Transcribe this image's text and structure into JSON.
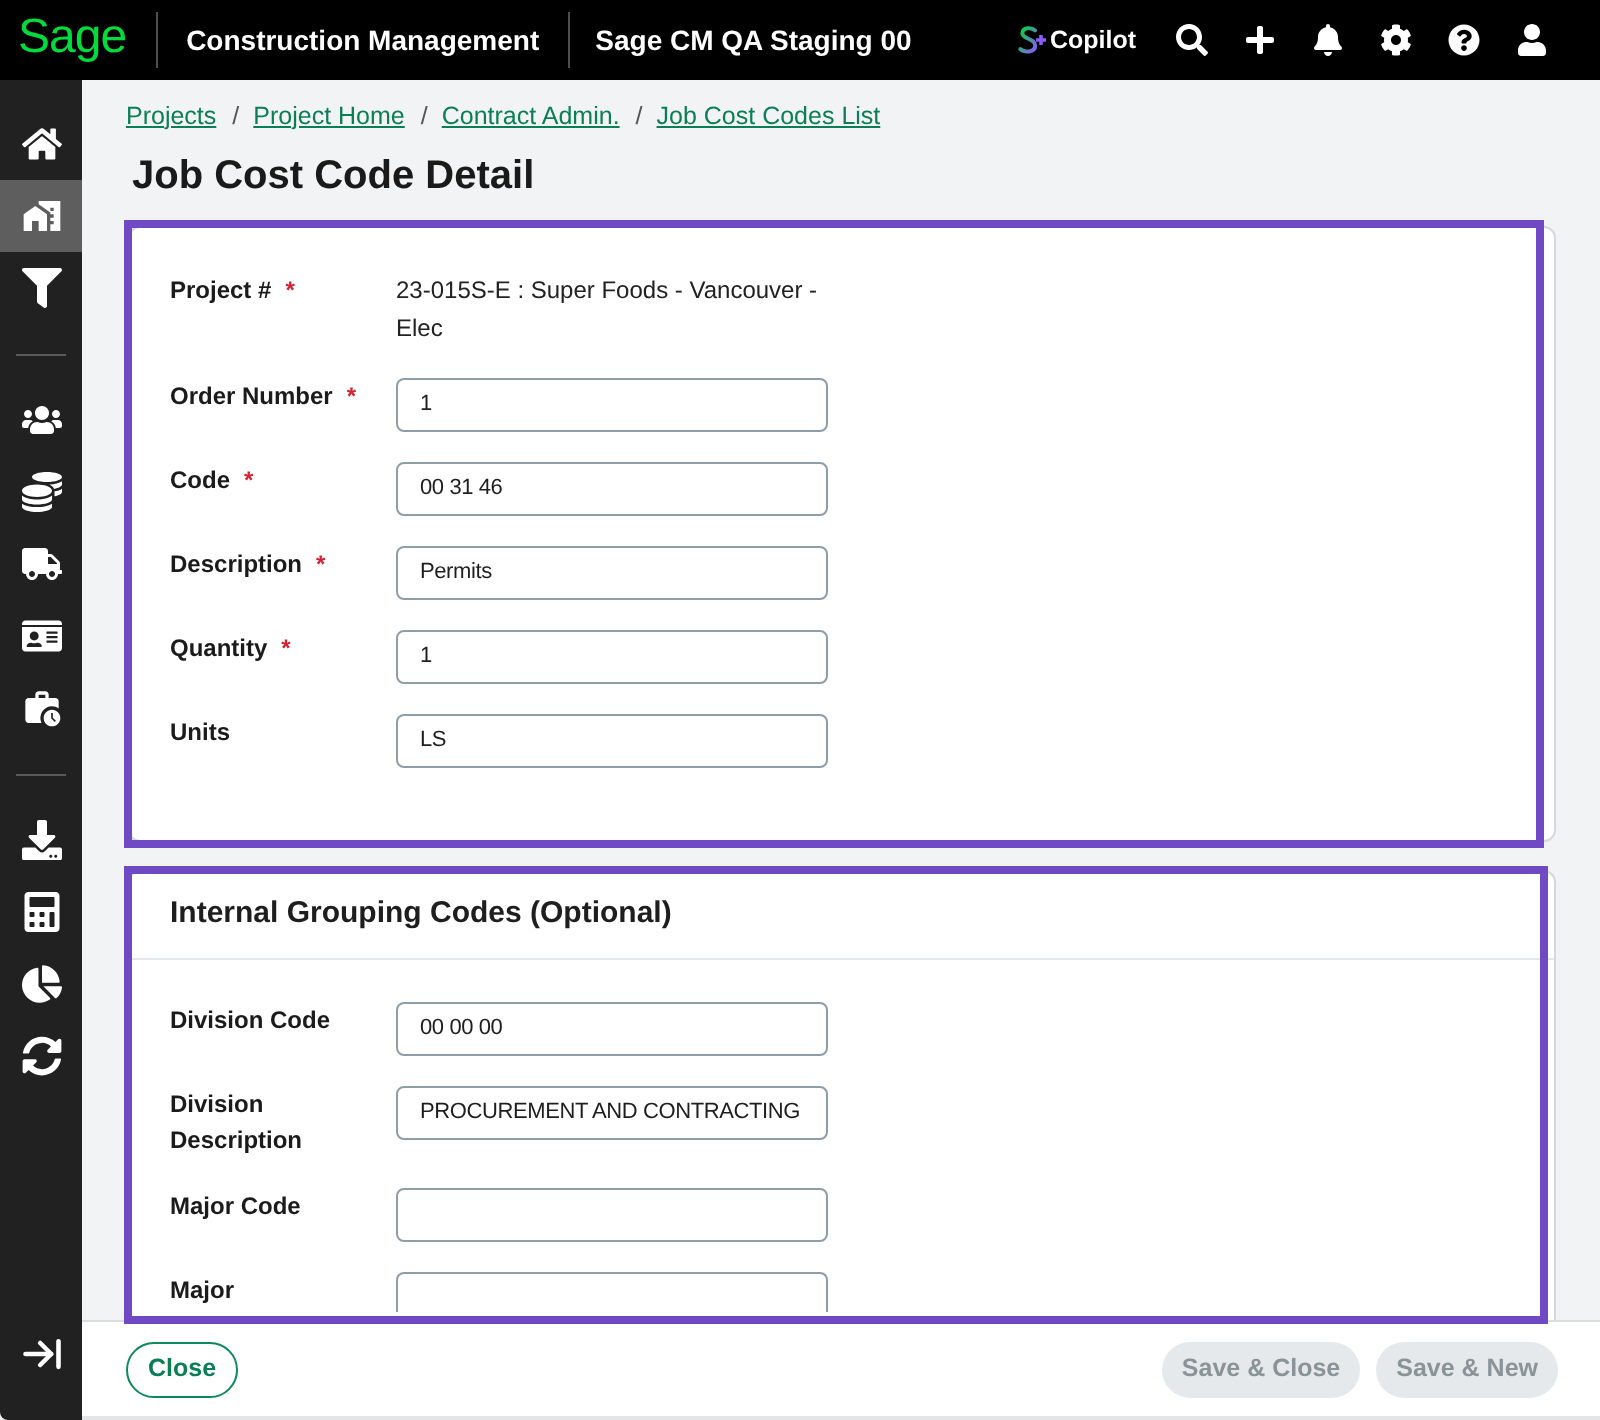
{
  "header": {
    "logo": "Sage",
    "app_name": "Construction Management",
    "environment": "Sage CM QA Staging 00",
    "copilot": "Copilot"
  },
  "sidebar": {
    "groups": [
      [
        {
          "selected": false
        },
        {
          "selected": true
        },
        {
          "selected": false
        }
      ],
      [
        {
          "selected": false
        },
        {
          "selected": false
        },
        {
          "selected": false
        },
        {
          "selected": false
        },
        {
          "selected": false
        }
      ],
      [
        {
          "selected": false
        },
        {
          "selected": false
        },
        {
          "selected": false
        },
        {
          "selected": false
        }
      ]
    ]
  },
  "breadcrumbs": [
    {
      "label": "Projects",
      "separator": "/"
    },
    {
      "label": "Project Home",
      "separator": "/"
    },
    {
      "label": "Contract Admin.",
      "separator": "/"
    },
    {
      "label": "Job Cost Codes List"
    }
  ],
  "title": "Job Cost Code Detail",
  "sections": [
    {
      "highlighted": true,
      "fields": [
        {
          "label": "Project #",
          "required_mark": "*",
          "kind": "text",
          "value": "23-015S-E : Super Foods - Vancouver - Elec"
        },
        {
          "label": "Order Number",
          "required_mark": "*",
          "kind": "input",
          "value": "1"
        },
        {
          "label": "Code",
          "required_mark": "*",
          "kind": "input",
          "value": "00 31 46"
        },
        {
          "label": "Description",
          "required_mark": "*",
          "kind": "input",
          "value": "Permits"
        },
        {
          "label": "Quantity",
          "required_mark": "*",
          "kind": "input",
          "value": "1"
        },
        {
          "label": "Units",
          "kind": "input",
          "value": "LS"
        }
      ]
    },
    {
      "title": "Internal Grouping Codes (Optional)",
      "highlighted": true,
      "fields": [
        {
          "label": "Division Code",
          "kind": "input",
          "value": "00 00 00"
        },
        {
          "label": "Division Description",
          "kind": "input",
          "value": "PROCUREMENT AND CONTRACTING"
        },
        {
          "label": "Major Code",
          "kind": "input"
        },
        {
          "label": "Major",
          "kind": "cut_input"
        }
      ]
    }
  ],
  "footer": {
    "buttons": [
      {
        "label": "Close",
        "kind": "outline",
        "disabled": false
      },
      {
        "label": "Save & Close",
        "kind": "solid",
        "disabled": true
      },
      {
        "label": "Save & New",
        "kind": "solid",
        "disabled": true
      }
    ]
  }
}
